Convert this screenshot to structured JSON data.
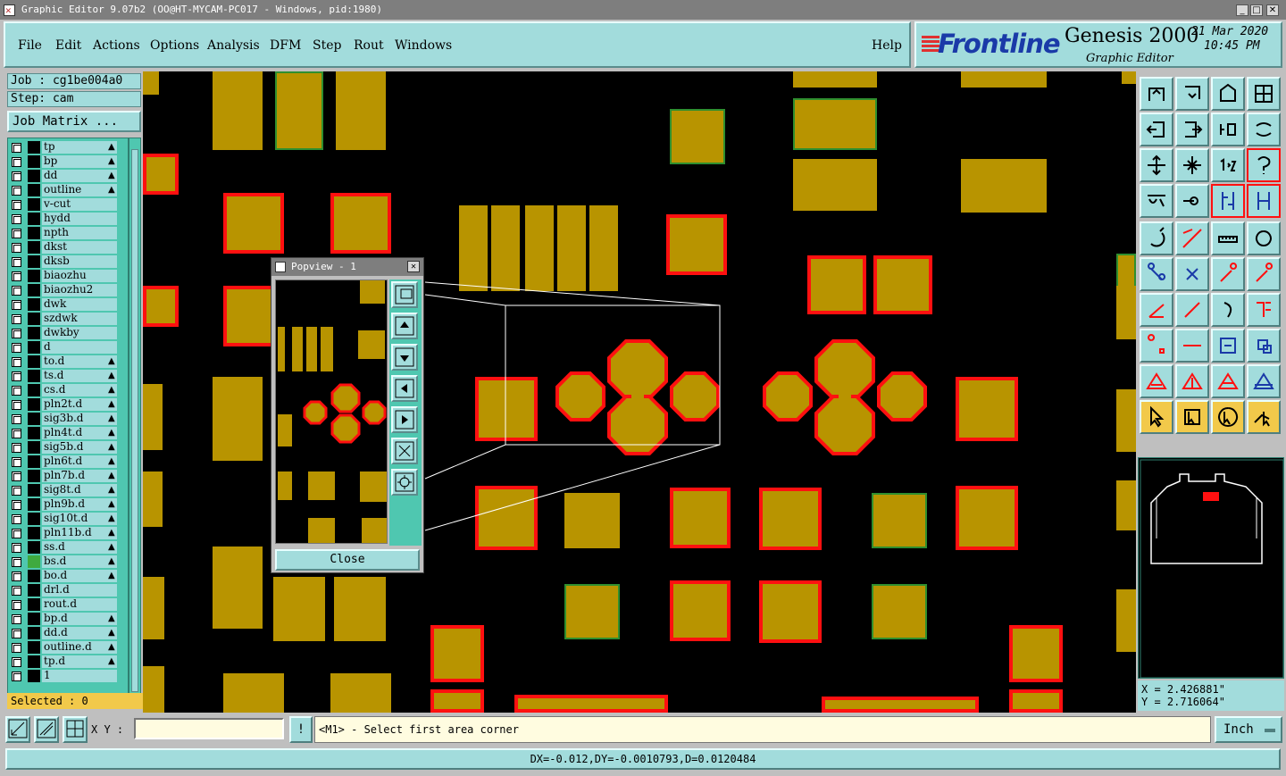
{
  "window": {
    "title": "Graphic Editor 9.07b2 (OO@HT-MYCAM-PC017 - Windows, pid:1980)",
    "buttons": [
      "_",
      "□",
      "✕"
    ]
  },
  "menu": {
    "items": [
      "File",
      "Edit",
      "Actions",
      "Options",
      "Analysis",
      "DFM",
      "Step",
      "Rout",
      "Windows"
    ],
    "help": "Help"
  },
  "brand": {
    "logo": "Frontline",
    "product": "Genesis 2000",
    "subtitle": "Graphic Editor",
    "date": "21 Mar 2020",
    "time": "10:45 PM"
  },
  "job": {
    "job_line": "Job : cg1be004a0",
    "step_line": "Step: cam",
    "matrix_button": "Job Matrix ..."
  },
  "layers": [
    {
      "name": "tp",
      "flag": "▲"
    },
    {
      "name": "bp",
      "flag": "▲"
    },
    {
      "name": "dd",
      "flag": "▲"
    },
    {
      "name": "outline",
      "flag": "▲"
    },
    {
      "name": "v-cut",
      "flag": ""
    },
    {
      "name": "hydd",
      "flag": ""
    },
    {
      "name": "npth",
      "flag": ""
    },
    {
      "name": "dkst",
      "flag": ""
    },
    {
      "name": "dksb",
      "flag": ""
    },
    {
      "name": "biaozhu",
      "flag": ""
    },
    {
      "name": "biaozhu2",
      "flag": ""
    },
    {
      "name": "dwk",
      "flag": ""
    },
    {
      "name": "szdwk",
      "flag": ""
    },
    {
      "name": "dwkby",
      "flag": ""
    },
    {
      "name": "d",
      "flag": ""
    },
    {
      "name": "to.d",
      "flag": "▲"
    },
    {
      "name": "ts.d",
      "flag": "▲"
    },
    {
      "name": "cs.d",
      "flag": "▲"
    },
    {
      "name": "pln2t.d",
      "flag": "▲"
    },
    {
      "name": "sig3b.d",
      "flag": "▲"
    },
    {
      "name": "pln4t.d",
      "flag": "▲"
    },
    {
      "name": "sig5b.d",
      "flag": "▲"
    },
    {
      "name": "pln6t.d",
      "flag": "▲"
    },
    {
      "name": "pln7b.d",
      "flag": "▲"
    },
    {
      "name": "sig8t.d",
      "flag": "▲"
    },
    {
      "name": "pln9b.d",
      "flag": "▲"
    },
    {
      "name": "sig10t.d",
      "flag": "▲"
    },
    {
      "name": "pln11b.d",
      "flag": "▲"
    },
    {
      "name": "ss.d",
      "flag": "▲"
    },
    {
      "name": "bs.d",
      "flag": "▲",
      "active": true
    },
    {
      "name": "bo.d",
      "flag": "▲"
    },
    {
      "name": "drl.d",
      "flag": ""
    },
    {
      "name": "rout.d",
      "flag": ""
    },
    {
      "name": "bp.d",
      "flag": "▲"
    },
    {
      "name": "dd.d",
      "flag": "▲"
    },
    {
      "name": "outline.d",
      "flag": "▲"
    },
    {
      "name": "tp.d",
      "flag": "▲"
    },
    {
      "name": "1",
      "flag": ""
    }
  ],
  "selected": "Selected : 0",
  "popview": {
    "title": "Popview - 1",
    "close_label": "Close"
  },
  "coords": {
    "x": "X = 2.426881\"",
    "y": "Y = 2.716064\""
  },
  "bottom": {
    "xy_label": "X Y :",
    "xy_value": "",
    "message": "<M1> - Select first area corner",
    "unit": "Inch",
    "status": "DX=-0.012,DY=-0.0010793,D=0.0120484"
  },
  "colors": {
    "panel": "#a2dcdc",
    "pad_fill": "#b89400",
    "highlight": "#ff1010",
    "board": "#000000"
  }
}
